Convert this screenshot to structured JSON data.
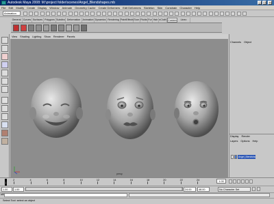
{
  "window": {
    "title": "Autodesk Maya 2008: M:\\project folder\\scenes\\Angel_Blendshapes.mb",
    "controls": [
      "minimize-icon",
      "maximize-icon",
      "close-icon"
    ]
  },
  "menubar": {
    "items": [
      "File",
      "Edit",
      "Modify",
      "Create",
      "Display",
      "Window",
      "Animate",
      "Geometry Cache",
      "Create Deformers",
      "Edit Deformers",
      "Skeleton",
      "Skin",
      "Constrain",
      "Character",
      "Help"
    ]
  },
  "status_line": {
    "mode": "Animation"
  },
  "shelf": {
    "tabs": [
      "General",
      "Curves",
      "Surfaces",
      "Polygons",
      "Subdivs",
      "Deformation",
      "Animation",
      "Dynamics",
      "Rendering",
      "PaintEffects",
      "Toon",
      "Fluids",
      "Fur",
      "Hair",
      "nCloth",
      "Custom",
      "Lineo Menu"
    ],
    "active_tab": "Custom",
    "icon_colors": [
      "#c03030",
      "#d04040",
      "#808080",
      "#909090",
      "#a0a0a0",
      "#7a7a7a",
      "#8a8a8a",
      "#b0b0b0",
      "#9a9a9a",
      "#707070"
    ]
  },
  "viewport": {
    "menus": [
      "View",
      "Shading",
      "Lighting",
      "Show",
      "Renderer",
      "Panels"
    ],
    "camera_label": "persp",
    "background": "#8d8d8d"
  },
  "channel_box": {
    "tabs": [
      "Channels",
      "Object"
    ]
  },
  "layer_editor": {
    "modes": [
      "Display",
      "Render"
    ],
    "menus": [
      "Layers",
      "Options",
      "Help"
    ],
    "layers": [
      {
        "name": "Angel_Blendshape_layer",
        "visible": true
      }
    ]
  },
  "time_slider": {
    "ticks": [
      "1",
      "2",
      "4",
      "6",
      "8",
      "10",
      "12",
      "14",
      "16",
      "18",
      "20",
      "22",
      "24"
    ],
    "current_frame": "1.00"
  },
  "range_slider": {
    "start_time": "1.00",
    "start_range": "1.00",
    "end_range": "24.00",
    "end_time": "48.00",
    "character_set": "No Character Set"
  },
  "command_line": {
    "prefix": "MEL"
  },
  "help_line": {
    "text": "Select Tool: select an object"
  },
  "colors": {
    "titlebar_start": "#0a246a",
    "layer_selected": "#2d57b5"
  }
}
